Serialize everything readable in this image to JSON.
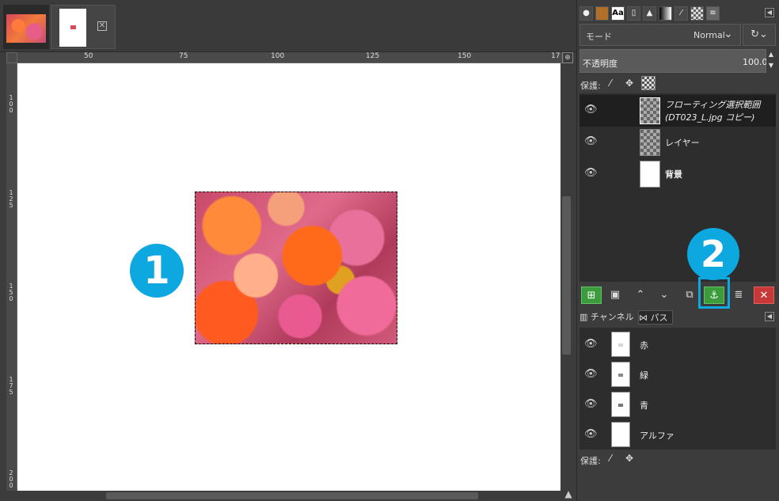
{
  "image_tabs": [
    {
      "name": "gerbera-photo",
      "active": false
    },
    {
      "name": "white-canvas",
      "active": true,
      "close_icon": "close-box-icon"
    }
  ],
  "ruler": {
    "h_ticks": [
      "50",
      "75",
      "100",
      "125",
      "150",
      "17"
    ],
    "v_ticks": [
      "1\n0\n0",
      "1\n2\n5",
      "1\n5\n0",
      "1\n7\n5",
      "2\n0\n0"
    ]
  },
  "markers": {
    "one": "1",
    "two": "2"
  },
  "dock": {
    "tab_icons": [
      "brush-icon",
      "pattern-icon",
      "font-icon",
      "document-icon",
      "shape-icon",
      "gradient-icon",
      "pencil-icon",
      "checker-icon",
      "layers-icon"
    ],
    "tab_font_label": "Aa"
  },
  "layers_panel": {
    "mode_label": "モード",
    "mode_value": "Normal",
    "opacity_label": "不透明度",
    "opacity_value": "100.0",
    "lock_label": "保護:",
    "layers": [
      {
        "name_line1": "フローティング選択範囲",
        "name_line2": "(DT023_L.jpg コピー)",
        "italic": true,
        "active": true,
        "thumb": "floating"
      },
      {
        "name_line1": "レイヤー",
        "italic": false,
        "active": false,
        "thumb": "transparent"
      },
      {
        "name_line1": "背景",
        "italic": false,
        "bold": true,
        "active": false,
        "thumb": "white"
      }
    ],
    "tools": [
      "new-layer-button",
      "layer-group-button",
      "raise-layer-button",
      "lower-layer-button",
      "duplicate-layer-button",
      "anchor-layer-button",
      "merge-down-button",
      "delete-layer-button"
    ]
  },
  "channels_panel": {
    "tab_channels": "チャンネル",
    "tab_paths": "パス",
    "lock_label": "保護:",
    "channels": [
      {
        "name": "赤",
        "color": "#d8d8d8"
      },
      {
        "name": "緑",
        "color": "#888888"
      },
      {
        "name": "青",
        "color": "#777777"
      },
      {
        "name": "アルファ",
        "color": "#ffffff"
      }
    ]
  }
}
